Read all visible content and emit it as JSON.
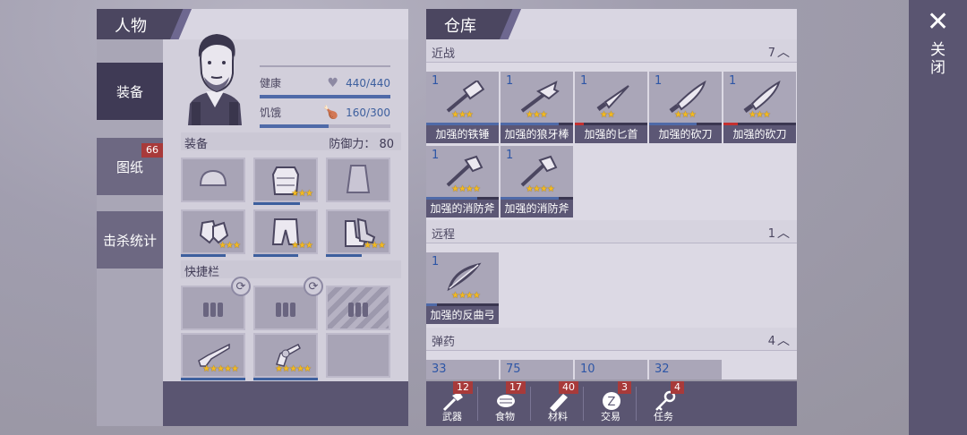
{
  "character_panel": {
    "title": "人物",
    "tabs": [
      {
        "label": "装备",
        "badge": ""
      },
      {
        "label": "图纸",
        "badge": "66"
      },
      {
        "label": "击杀统计",
        "badge": ""
      }
    ],
    "stats": {
      "health_label": "健康",
      "health_value": "440/440",
      "health_fraction": 1.0,
      "hunger_label": "饥饿",
      "hunger_value": "160/300",
      "hunger_fraction": 0.53
    },
    "equipment": {
      "label": "装备",
      "defense": "防御力： 80"
    },
    "quickbar": {
      "label": "快捷栏"
    }
  },
  "warehouse": {
    "title": "仓库",
    "sections": [
      {
        "label": "近战",
        "count": "7"
      },
      {
        "label": "远程",
        "count": "1"
      },
      {
        "label": "弹药",
        "count": "4"
      }
    ],
    "melee_items": [
      {
        "qty": "1",
        "name": "加强的铁锤",
        "icon": "hammer-icon",
        "durability": 1.0,
        "warn": false
      },
      {
        "qty": "1",
        "name": "加强的狼牙棒",
        "icon": "mace-icon",
        "durability": 0.8,
        "warn": false
      },
      {
        "qty": "1",
        "name": "加强的匕首",
        "icon": "dagger-icon",
        "durability": 0.12,
        "warn": true
      },
      {
        "qty": "1",
        "name": "加强的砍刀",
        "icon": "machete-icon",
        "durability": 0.65,
        "warn": false
      },
      {
        "qty": "1",
        "name": "加强的砍刀",
        "icon": "machete-icon",
        "durability": 0.2,
        "warn": true
      },
      {
        "qty": "1",
        "name": "加强的消防斧",
        "icon": "fire-axe-icon",
        "durability": 0.7,
        "warn": false
      },
      {
        "qty": "1",
        "name": "加强的消防斧",
        "icon": "fire-axe-icon",
        "durability": 0.8,
        "warn": false
      }
    ],
    "ranged_items": [
      {
        "qty": "1",
        "name": "加强的反曲弓",
        "icon": "recurve-bow-icon",
        "durability": 0.15,
        "warn": false
      }
    ],
    "ammo_items": [
      {
        "qty": "33"
      },
      {
        "qty": "75"
      },
      {
        "qty": "10"
      },
      {
        "qty": "32"
      }
    ],
    "categories": [
      {
        "label": "武器",
        "count": "12",
        "icon": "weapon-icon"
      },
      {
        "label": "食物",
        "count": "17",
        "icon": "food-icon"
      },
      {
        "label": "材料",
        "count": "40",
        "icon": "material-icon"
      },
      {
        "label": "交易",
        "count": "3",
        "icon": "trade-coin-icon"
      },
      {
        "label": "任务",
        "count": "4",
        "icon": "key-icon"
      }
    ]
  },
  "close": {
    "symbol": "✕",
    "label": "关闭"
  },
  "colors": {
    "accent": "#4f6aa8",
    "panel_dark": "#5a5571",
    "badge": "#a83a3a",
    "star": "#f3b91f"
  }
}
